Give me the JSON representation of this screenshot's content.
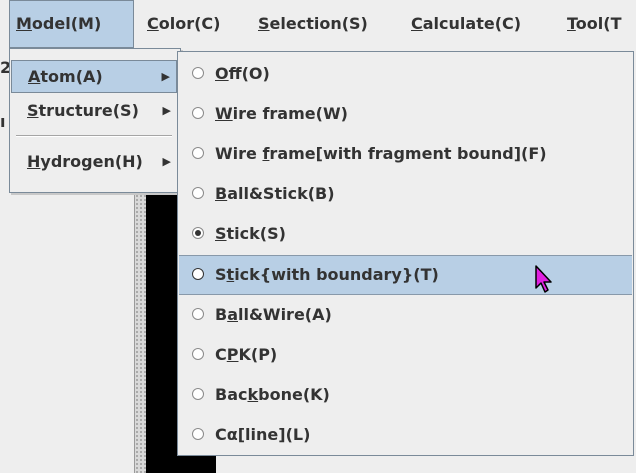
{
  "menubar": {
    "items": [
      {
        "pre": "",
        "key": "M",
        "post": "odel(M)"
      },
      {
        "pre": "",
        "key": "C",
        "post": "olor(C)"
      },
      {
        "pre": "",
        "key": "S",
        "post": "election(S)"
      },
      {
        "pre": "",
        "key": "C",
        "post": "alculate(C)"
      },
      {
        "pre": "",
        "key": "T",
        "post": "ool(T"
      }
    ]
  },
  "model_menu": {
    "items": [
      {
        "pre": "",
        "key": "A",
        "post": "tom(A)"
      },
      {
        "pre": "",
        "key": "S",
        "post": "tructure(S)"
      },
      {
        "pre": "",
        "key": "H",
        "post": "ydrogen(H)"
      }
    ]
  },
  "atom_submenu": {
    "items": [
      {
        "pre": "",
        "key": "O",
        "post": "ff(O)",
        "selected": false
      },
      {
        "pre": "",
        "key": "W",
        "post": "ire frame(W)",
        "selected": false
      },
      {
        "pre": "Wire ",
        "key": "f",
        "post": "rame[with fragment bound](F)",
        "selected": false
      },
      {
        "pre": "",
        "key": "B",
        "post": "all&Stick(B)",
        "selected": false
      },
      {
        "pre": "",
        "key": "S",
        "post": "tick(S)",
        "selected": true
      },
      {
        "pre": "S",
        "key": "t",
        "post": "ick{with boundary}(T)",
        "selected": false
      },
      {
        "pre": "B",
        "key": "a",
        "post": "ll&Wire(A)",
        "selected": false
      },
      {
        "pre": "C",
        "key": "P",
        "post": "K(P)",
        "selected": false
      },
      {
        "pre": "Bac",
        "key": "k",
        "post": "bone(K)",
        "selected": false
      },
      {
        "pre": "Cα",
        "key": "[",
        "post": "line](L)",
        "selected": false
      }
    ]
  },
  "background": {
    "left_char_1": "2",
    "left_char_2": "ı"
  },
  "colors": {
    "highlight": "#b8cfe5",
    "menu_bg": "#eeeeee",
    "border": "#7a8a99",
    "cursor": "#e020e0"
  }
}
